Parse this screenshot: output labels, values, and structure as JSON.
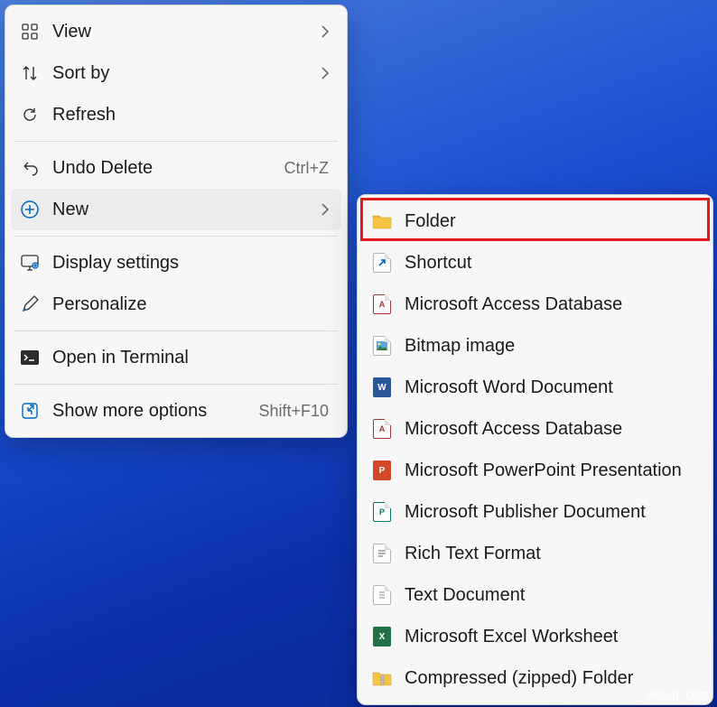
{
  "main_menu": {
    "view": "View",
    "sort_by": "Sort by",
    "refresh": "Refresh",
    "undo_delete": "Undo Delete",
    "undo_shortcut": "Ctrl+Z",
    "new": "New",
    "display_settings": "Display settings",
    "personalize": "Personalize",
    "open_terminal": "Open in Terminal",
    "show_more": "Show more options",
    "show_more_shortcut": "Shift+F10"
  },
  "sub_menu": {
    "folder": "Folder",
    "shortcut": "Shortcut",
    "access_db": "Microsoft Access Database",
    "bitmap": "Bitmap image",
    "word": "Microsoft Word Document",
    "access_db2": "Microsoft Access Database",
    "powerpoint": "Microsoft PowerPoint Presentation",
    "publisher": "Microsoft Publisher Document",
    "rtf": "Rich Text Format",
    "text": "Text Document",
    "excel": "Microsoft Excel Worksheet",
    "zip": "Compressed (zipped) Folder"
  },
  "watermark": "wsxdn.com",
  "colors": {
    "highlight": "#e11b1b",
    "word": "#2b579a",
    "excel": "#217346",
    "powerpoint": "#d24726",
    "access": "#a4373a",
    "publisher": "#077568",
    "folder": "#f5c443",
    "link": "#0067c0"
  }
}
